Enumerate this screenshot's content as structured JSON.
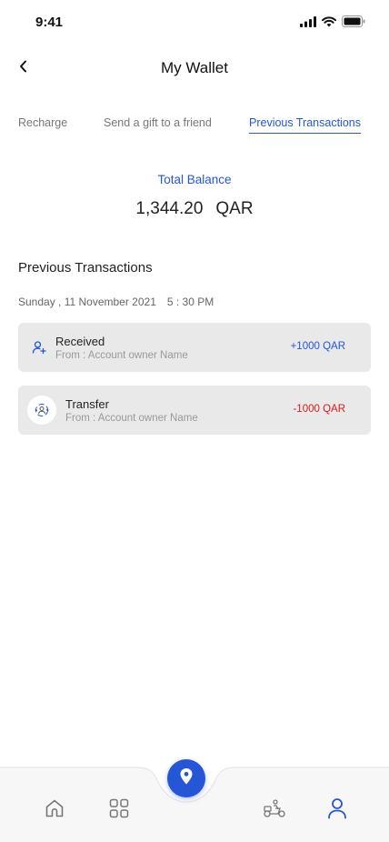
{
  "status_bar": {
    "time": "9:41",
    "icons": [
      "signal-icon",
      "wifi-icon",
      "battery-icon"
    ]
  },
  "header": {
    "title": "My Wallet",
    "back_icon": "chevron-left-icon"
  },
  "tabs": [
    {
      "label": "Recharge",
      "active": false
    },
    {
      "label": "Send a gift to a friend",
      "active": false
    },
    {
      "label": "Previous Transactions",
      "active": true
    }
  ],
  "balance": {
    "label": "Total Balance",
    "amount": "1,344.20",
    "currency": "QAR"
  },
  "transactions_section": {
    "title": "Previous Transactions",
    "date": "Sunday , 11 November 2021",
    "time": "5 : 30 PM",
    "items": [
      {
        "title": "Received",
        "subtitle": "From : Account owner Name",
        "amount": "+1000 QAR",
        "icon": "user-add-icon",
        "amount_color": "#2456d6"
      },
      {
        "title": "Transfer",
        "subtitle": "From : Account owner Name",
        "amount": "-1000 QAR",
        "icon": "transfer-icon",
        "amount_color": "#e01818"
      }
    ]
  },
  "bottom_nav": {
    "items": [
      "home-icon",
      "grid-icon",
      "location-pin-icon",
      "delivery-scooter-icon",
      "profile-icon"
    ],
    "active": "profile-icon"
  },
  "colors": {
    "accent": "#2456d6",
    "negative": "#e01818",
    "card_bg": "#e9e9e9"
  }
}
